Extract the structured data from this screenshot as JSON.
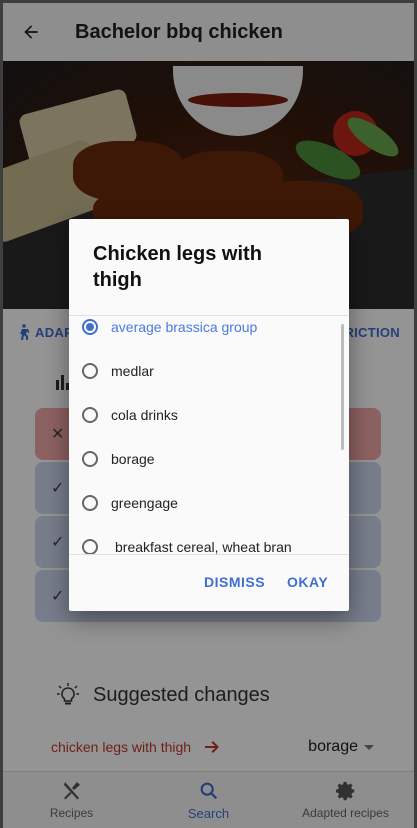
{
  "app_bar": {
    "title": "Bachelor bbq chicken",
    "back_icon": "arrow-back-icon"
  },
  "actions": {
    "left_label": "ADAP",
    "right_label": "RICTION"
  },
  "cards": [
    {
      "status": "fail",
      "icon": "✕"
    },
    {
      "status": "ok",
      "icon": "✓"
    },
    {
      "status": "ok",
      "icon": "✓"
    },
    {
      "status": "ok",
      "icon": "✓"
    }
  ],
  "suggested": {
    "title": "Suggested changes",
    "from": "chicken legs with thigh",
    "to": "borage"
  },
  "bottom_nav": [
    {
      "label": "Recipes",
      "icon": "fork-knife-icon",
      "active": false
    },
    {
      "label": "Search",
      "icon": "search-icon",
      "active": true
    },
    {
      "label": "Adapted recipes",
      "icon": "gear-icon",
      "active": false
    }
  ],
  "dialog": {
    "title": "Chicken legs with thigh",
    "options": [
      {
        "label": "average brassica group",
        "selected": true
      },
      {
        "label": "medlar",
        "selected": false
      },
      {
        "label": "cola drinks",
        "selected": false
      },
      {
        "label": "borage",
        "selected": false
      },
      {
        "label": "greengage",
        "selected": false
      },
      {
        "label": "breakfast cereal, wheat bran",
        "selected": false
      }
    ],
    "dismiss_label": "DISMISS",
    "okay_label": "OKAY"
  },
  "colors": {
    "accent": "#3f6fd1",
    "error": "#c0392b",
    "error_card": "#f2a7a7",
    "ok_card": "#cdd7f0"
  }
}
